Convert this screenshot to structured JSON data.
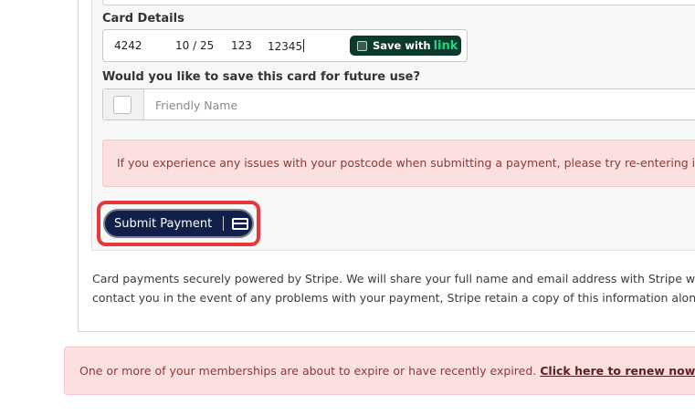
{
  "card_details": {
    "label": "Card Details",
    "card_number": "4242",
    "expiry": "10 / 25",
    "cvc": "123",
    "postcode": "12345",
    "link_button": {
      "prefix": "Save with",
      "brand": "link"
    }
  },
  "save_card": {
    "label": "Would you like to save this card for future use?",
    "friendly_name_placeholder": "Friendly Name"
  },
  "postcode_alert": {
    "text": "If you experience any issues with your postcode when submitting a payment, please try re-entering it m"
  },
  "submit": {
    "label": "Submit Payment",
    "icon": "credit-card-icon"
  },
  "disclaimer": {
    "line1": "Card payments securely powered by Stripe. We will share your full name and email address with Stripe wher",
    "line2": "contact you in the event of any problems with your payment, Stripe retain a copy of this information along w"
  },
  "expire_alert": {
    "text": "One or more of your memberships are about to expire or have recently expired.",
    "link": "Click here to renew now"
  },
  "colors": {
    "submit_bg": "#10204a",
    "highlight": "#e5383b",
    "alert_bg": "#fce0e0",
    "link_bg": "#0c3a2c",
    "link_brand": "#20d67b"
  }
}
